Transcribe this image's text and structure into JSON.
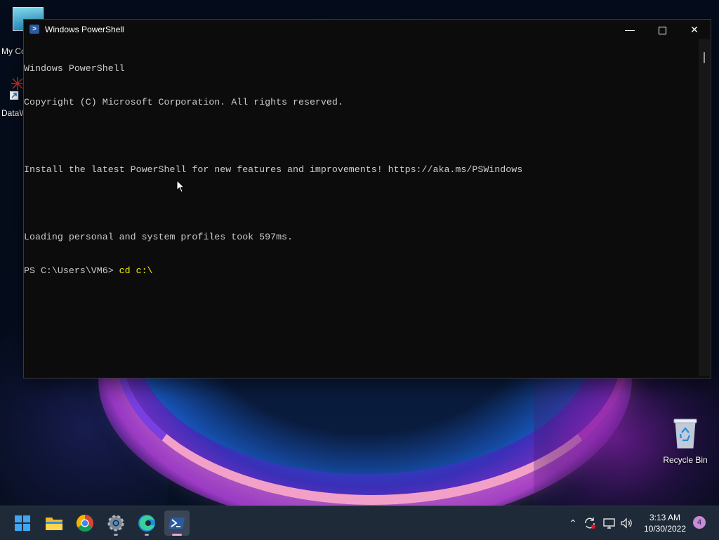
{
  "desktop": {
    "icons": [
      {
        "label": "My Co"
      },
      {
        "label": "DataW"
      },
      {
        "label": "Recycle Bin"
      }
    ]
  },
  "window": {
    "title": "Windows PowerShell",
    "title_icon": "powershell-icon",
    "controls": {
      "minimize": "minimize-icon",
      "maximize": "maximize-icon",
      "close": "close-icon"
    },
    "console_lines": [
      "Windows PowerShell",
      "Copyright (C) Microsoft Corporation. All rights reserved.",
      "",
      "Install the latest PowerShell for new features and improvements! https://aka.ms/PSWindows",
      "",
      "Loading personal and system profiles took 597ms."
    ],
    "prompt": "PS C:\\Users\\VM6> ",
    "command": "cd c:\\"
  },
  "taskbar": {
    "apps": [
      {
        "name": "start-icon"
      },
      {
        "name": "file-explorer-icon"
      },
      {
        "name": "chrome-icon"
      },
      {
        "name": "settings-icon"
      },
      {
        "name": "edge-icon"
      },
      {
        "name": "powershell-icon",
        "active": true
      }
    ],
    "tray": {
      "icons": [
        "chevron-up-icon",
        "sync-icon",
        "network-icon",
        "volume-icon"
      ],
      "time": "3:13 AM",
      "date": "10/30/2022",
      "notification_count": "4"
    }
  },
  "colors": {
    "console_bg": "#0c0c0c",
    "console_text": "#cccccc",
    "command_text": "#f2f200",
    "taskbar_bg": "#1f2a38"
  }
}
